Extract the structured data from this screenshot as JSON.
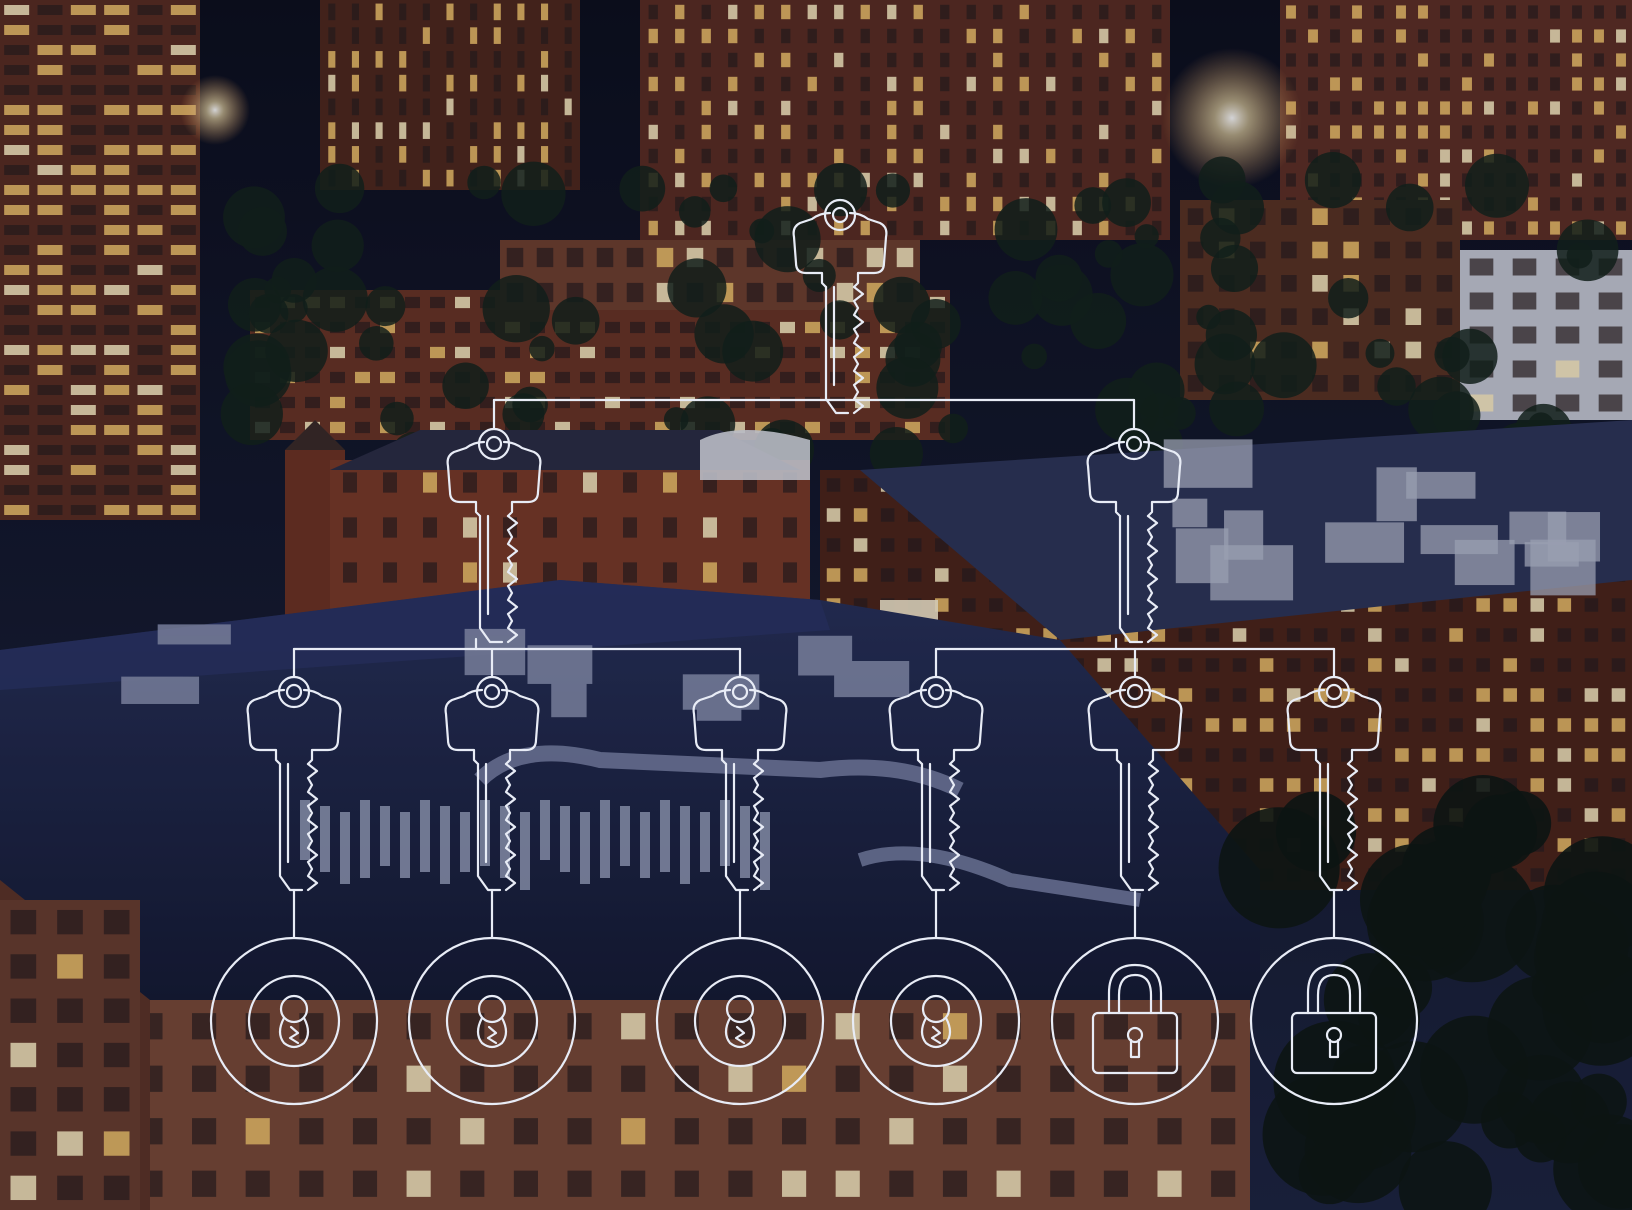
{
  "colors": {
    "sky_top": "#0b0e1c",
    "dusk": "#1c2440",
    "roof_navy": "#1d2647",
    "roof_dark": "#141a33",
    "brick": "#6e3222",
    "brick_dark": "#4a2218",
    "window_warm": "#f3c46a",
    "window_bright": "#fff1c4",
    "line_art": "#e8ecf6"
  },
  "diagram": {
    "root_key": {
      "icon": "key-icon",
      "role": "grand-master-key"
    },
    "master_keys": [
      {
        "icon": "key-icon",
        "role": "master-key-left"
      },
      {
        "icon": "key-icon",
        "role": "master-key-right"
      }
    ],
    "change_keys": [
      {
        "icon": "key-icon",
        "group": "left"
      },
      {
        "icon": "key-icon",
        "group": "left"
      },
      {
        "icon": "key-icon",
        "group": "left"
      },
      {
        "icon": "key-icon",
        "group": "right"
      },
      {
        "icon": "key-icon",
        "group": "right"
      },
      {
        "icon": "key-icon",
        "group": "right"
      }
    ],
    "locks": [
      {
        "icon": "keyhole-icon"
      },
      {
        "icon": "keyhole-icon"
      },
      {
        "icon": "keyhole-icon"
      },
      {
        "icon": "keyhole-icon"
      },
      {
        "icon": "padlock-icon"
      },
      {
        "icon": "padlock-icon"
      }
    ]
  }
}
